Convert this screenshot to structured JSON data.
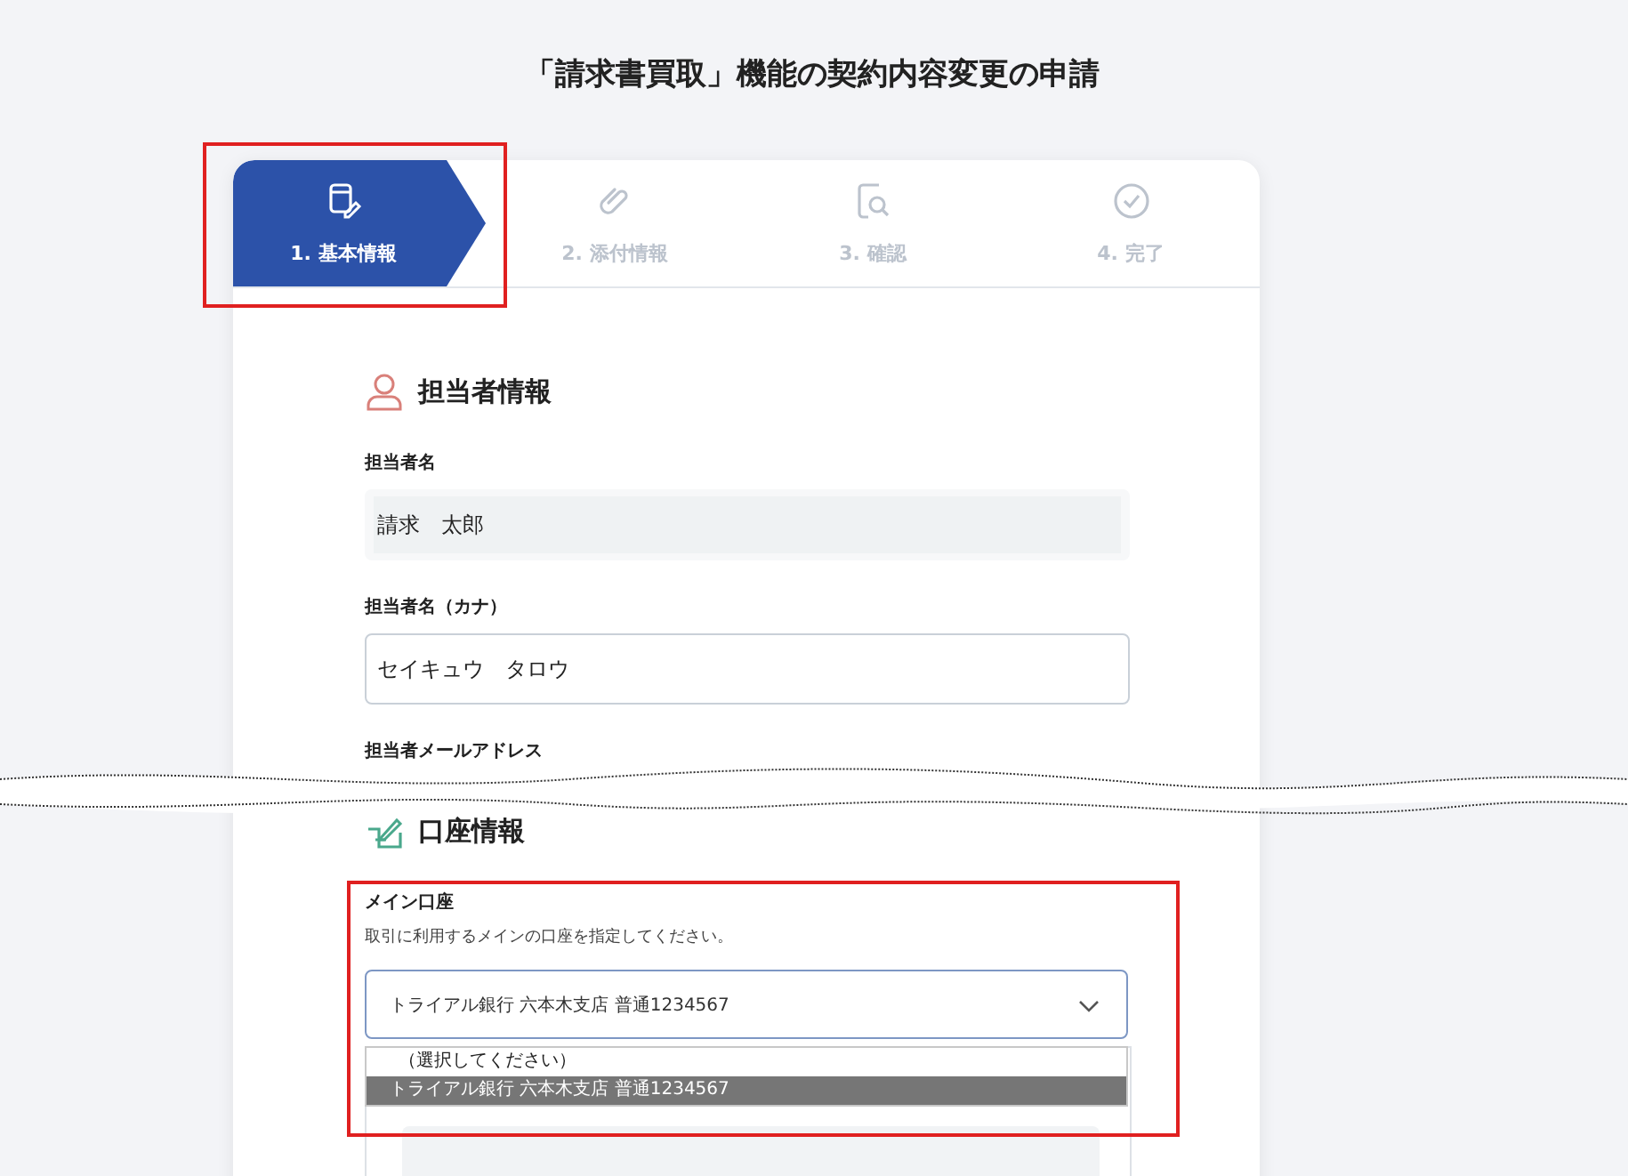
{
  "page_title": "「請求書買取」機能の契約内容変更の申請",
  "steps": [
    {
      "label": "1. 基本情報",
      "selected": true
    },
    {
      "label": "2. 添付情報",
      "selected": false
    },
    {
      "label": "3. 確認",
      "selected": false
    },
    {
      "label": "4. 完了",
      "selected": false
    }
  ],
  "sections": [
    {
      "title": "担当者情報",
      "kind": "person",
      "fields": [
        {
          "kind": "readonly",
          "label": "担当者名",
          "value": "請求　太郎"
        },
        {
          "kind": "input",
          "label": "担当者名（カナ）",
          "value": "セイキュウ　タロウ"
        },
        {
          "kind": "label_only",
          "label": "担当者メールアドレス"
        }
      ]
    },
    {
      "title": "口座情報",
      "kind": "account",
      "fields": [
        {
          "kind": "select",
          "label": "メイン口座",
          "help": "取引に利用するメインの口座を指定してください。",
          "value": "トライアル銀行 六本木支店 普通1234567",
          "expanded": true,
          "options": [
            {
              "label": "（選択してください）",
              "selected": false
            },
            {
              "label": "トライアル銀行 六本木支店 普通1234567",
              "selected": true
            }
          ]
        }
      ]
    }
  ]
}
